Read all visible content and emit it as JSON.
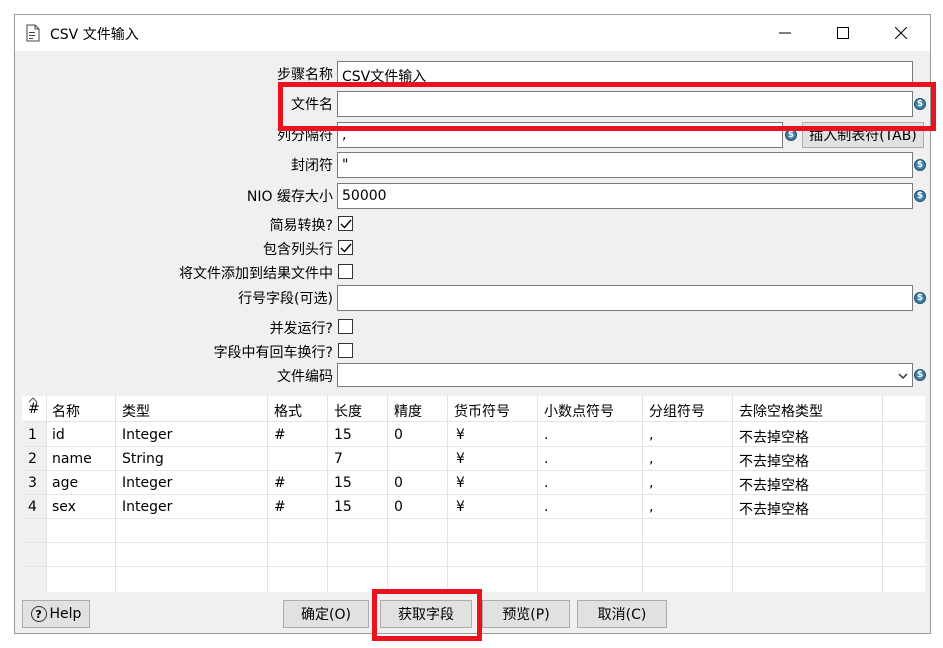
{
  "window": {
    "title": "CSV 文件输入",
    "controls": {
      "minimize": "—",
      "maximize": "□",
      "close": "✕"
    }
  },
  "form": {
    "step_name": {
      "label": "步骤名称",
      "value": "CSV文件输入"
    },
    "file_name": {
      "label": "文件名",
      "value": ""
    },
    "delimiter": {
      "label": "列分隔符",
      "value": ",",
      "insert_tab_label": "插入制表符(TAB)"
    },
    "enclosure": {
      "label": "封闭符",
      "value": "\""
    },
    "nio_buffer": {
      "label": "NIO 缓存大小",
      "value": "50000"
    },
    "lazy_conversion": {
      "label": "简易转换?",
      "checked": true
    },
    "header_row": {
      "label": "包含列头行",
      "checked": true
    },
    "add_filename_result": {
      "label": "将文件添加到结果文件中",
      "checked": false
    },
    "row_number_field": {
      "label": "行号字段(可选)",
      "value": ""
    },
    "parallel": {
      "label": "并发运行?",
      "checked": false
    },
    "newline_in_field": {
      "label": "字段中有回车换行?",
      "checked": false
    },
    "encoding": {
      "label": "文件编码",
      "value": ""
    }
  },
  "table": {
    "sort_glyph": "^",
    "columns": [
      "#",
      "名称",
      "类型",
      "格式",
      "长度",
      "精度",
      "货币符号",
      "小数点符号",
      "分组符号",
      "去除空格类型"
    ],
    "rows": [
      [
        "1",
        "id",
        "Integer",
        "#",
        "15",
        "0",
        "¥",
        ".",
        ",",
        "不去掉空格"
      ],
      [
        "2",
        "name",
        "String",
        "",
        "7",
        "",
        "¥",
        ".",
        ",",
        "不去掉空格"
      ],
      [
        "3",
        "age",
        "Integer",
        "#",
        "15",
        "0",
        "¥",
        ".",
        ",",
        "不去掉空格"
      ],
      [
        "4",
        "sex",
        "Integer",
        "#",
        "15",
        "0",
        "¥",
        ".",
        ",",
        "不去掉空格"
      ]
    ]
  },
  "buttons": {
    "help": "Help",
    "ok": "确定(O)",
    "get_fields": "获取字段",
    "preview": "预览(P)",
    "cancel": "取消(C)"
  },
  "colors": {
    "highlight": "#e8131f",
    "variable_icon": "#3d7fa6"
  }
}
